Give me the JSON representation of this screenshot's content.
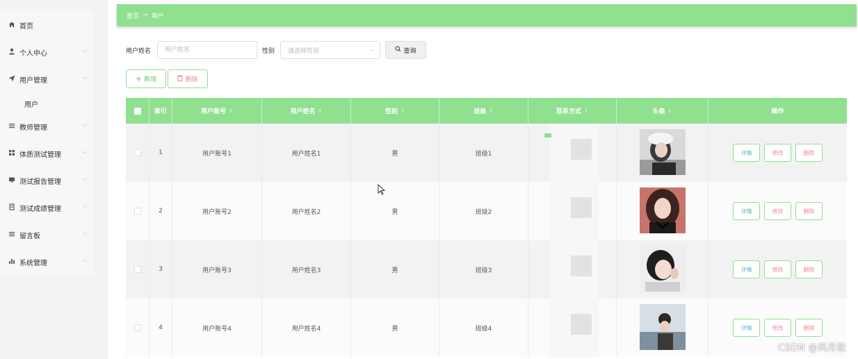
{
  "sidebar": {
    "items": [
      {
        "label": "首页",
        "icon": "home-icon",
        "has_chevron": false
      },
      {
        "label": "个人中心",
        "icon": "user-icon",
        "has_chevron": true
      },
      {
        "label": "用户管理",
        "icon": "send-icon",
        "has_chevron": true
      },
      {
        "label": "教师管理",
        "icon": "list-icon",
        "has_chevron": true
      },
      {
        "label": "体质测试管理",
        "icon": "grid-icon",
        "has_chevron": true
      },
      {
        "label": "测试报告管理",
        "icon": "monitor-icon",
        "has_chevron": true
      },
      {
        "label": "测试成绩管理",
        "icon": "document-icon",
        "has_chevron": true
      },
      {
        "label": "留言板",
        "icon": "list-icon",
        "has_chevron": true
      },
      {
        "label": "系统管理",
        "icon": "chart-icon",
        "has_chevron": true
      }
    ],
    "sub_item": "用户"
  },
  "breadcrumb": {
    "home": "首页",
    "separator": "→",
    "current": "用户"
  },
  "search": {
    "name_label": "用户姓名",
    "name_placeholder": "用户姓名",
    "gender_label": "性别",
    "gender_placeholder": "请选择性别",
    "query_button": "查询"
  },
  "actions": {
    "add_button": "新增",
    "delete_button": "删除"
  },
  "table": {
    "headers": {
      "index": "索引",
      "account": "用户账号",
      "name": "用户姓名",
      "gender": "性别",
      "class": "班级",
      "contact": "联系方式",
      "avatar": "头像",
      "operations": "操作"
    },
    "rows": [
      {
        "index": "1",
        "account": "用户账号1",
        "name": "用户姓名1",
        "gender": "男",
        "class": "班级1"
      },
      {
        "index": "2",
        "account": "用户账号2",
        "name": "用户姓名2",
        "gender": "男",
        "class": "班级2"
      },
      {
        "index": "3",
        "account": "用户账号3",
        "name": "用户姓名3",
        "gender": "男",
        "class": "班级3"
      },
      {
        "index": "4",
        "account": "用户账号4",
        "name": "用户姓名4",
        "gender": "男",
        "class": "班级4"
      }
    ],
    "op_labels": {
      "detail": "详情",
      "edit": "修改",
      "delete": "删除"
    }
  },
  "watermark": "CSDN @风月歌",
  "colors": {
    "accent": "#8fe08f",
    "edit": "#f08aa4",
    "detail": "#5bb8c6",
    "danger": "#f08a8a"
  }
}
